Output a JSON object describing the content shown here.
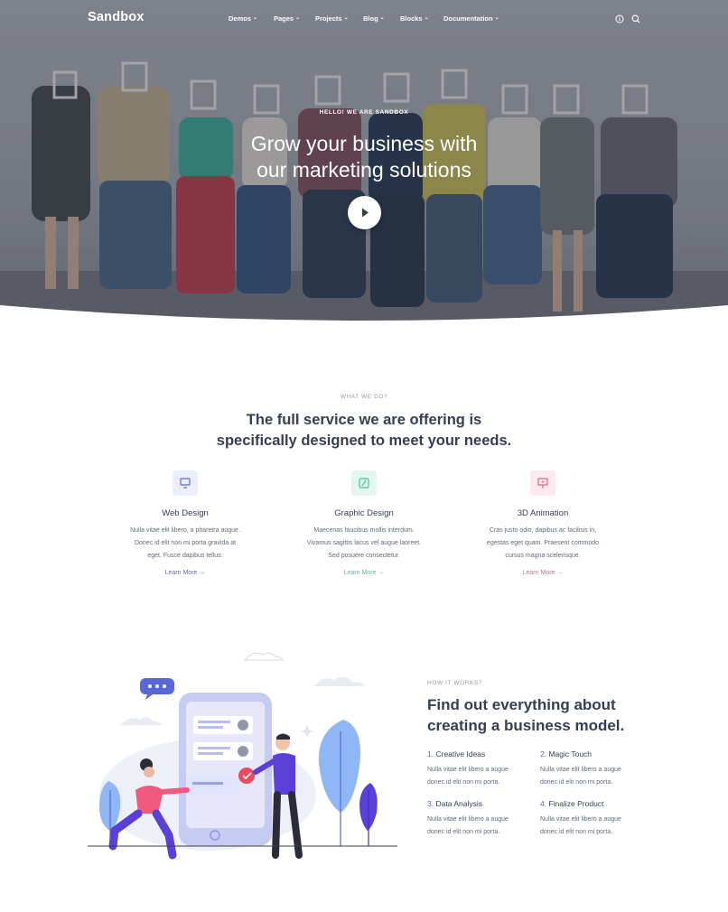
{
  "brand": {
    "logo": "Sandbox"
  },
  "nav": {
    "items": [
      "Demos",
      "Pages",
      "Projects",
      "Blog",
      "Blocks",
      "Documentation"
    ],
    "icons": [
      "info-icon",
      "search-icon"
    ]
  },
  "hero": {
    "eyebrow": "HELLO! WE ARE SANDBOX",
    "title_line1": "Grow your business with",
    "title_line2": "our marketing solutions"
  },
  "services": {
    "eyebrow": "WHAT WE DO?",
    "title_line1": "The full service we are offering is",
    "title_line2": "specifically designed to meet your needs.",
    "items": [
      {
        "title": "Web Design",
        "line1": "Nulla vitae elit libero, a pharetra augue.",
        "line2": "Donec id elit non mi porta gravida at",
        "line3": "eget. Fusce dapibus tellus.",
        "link": "Learn More →",
        "color": "#5a67d8",
        "bg": "#eceefb"
      },
      {
        "title": "Graphic Design",
        "line1": "Maecenas faucibus mollis interdum.",
        "line2": "Vivamus sagittis lacus vel augue laoreet.",
        "line3": "Sed posuere consectetur.",
        "link": "Learn More →",
        "color": "#45c4a0",
        "bg": "#e4f6f0"
      },
      {
        "title": "3D Animation",
        "line1": "Cras justo odio, dapibus ac facilisis in,",
        "line2": "egestas eget quam. Praesent commodo",
        "line3": "cursus magna scelerisque.",
        "link": "Learn More →",
        "color": "#d16b86",
        "bg": "#fbe9ee"
      }
    ]
  },
  "how": {
    "eyebrow": "HOW IT WORKS?",
    "title_line1": "Find out everything about",
    "title_line2": "creating a business model.",
    "steps": [
      {
        "num": "1.",
        "title": "Creative Ideas",
        "line1": "Nulla vitae elit libero a augue",
        "line2": "donec id elit non mi porta."
      },
      {
        "num": "2.",
        "title": "Magic Touch",
        "line1": "Nulla vitae elit libero a augue",
        "line2": "donec id elit non mi porta."
      },
      {
        "num": "3.",
        "title": "Data Analysis",
        "line1": "Nulla vitae elit libero a augue",
        "line2": "donec id elit non mi porta."
      },
      {
        "num": "4.",
        "title": "Finalize Product",
        "line1": "Nulla vitae elit libero a augue",
        "line2": "donec id elit non mi porta."
      }
    ]
  },
  "colors": {
    "accent": "#5a67d8",
    "text": "#343f52",
    "muted": "#60697b"
  }
}
